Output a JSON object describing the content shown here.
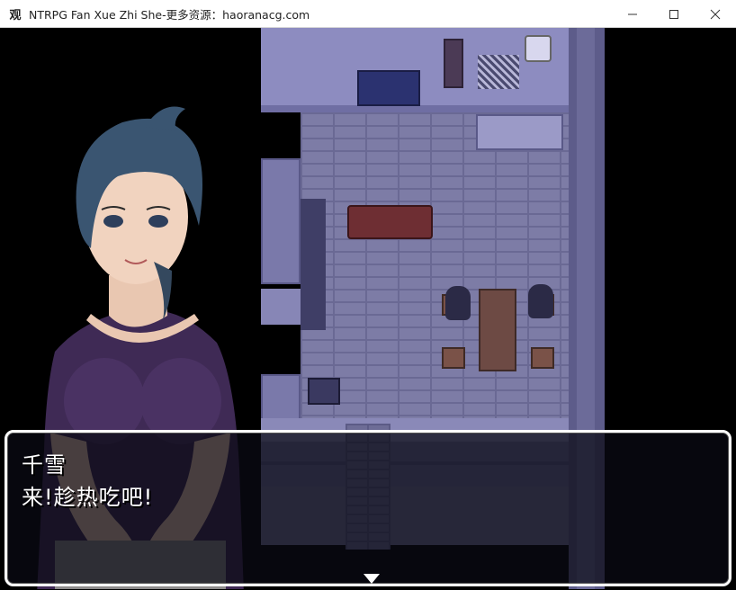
{
  "window": {
    "title": "NTRPG Fan Xue Zhi She-更多资源：haoranacg.com",
    "app_icon_glyph": "观",
    "buttons": [
      "minimize",
      "maximize",
      "close"
    ]
  },
  "dialogue": {
    "speaker": "千雪",
    "text": "来!趁热吃吧!",
    "advance_indicator": "triangle-down"
  },
  "colors": {
    "dialog_border": "#ffffff",
    "dialog_bg": "rgba(10,10,20,0.72)",
    "floor": "#7d7ca6",
    "wall": "#8d8cc0"
  }
}
